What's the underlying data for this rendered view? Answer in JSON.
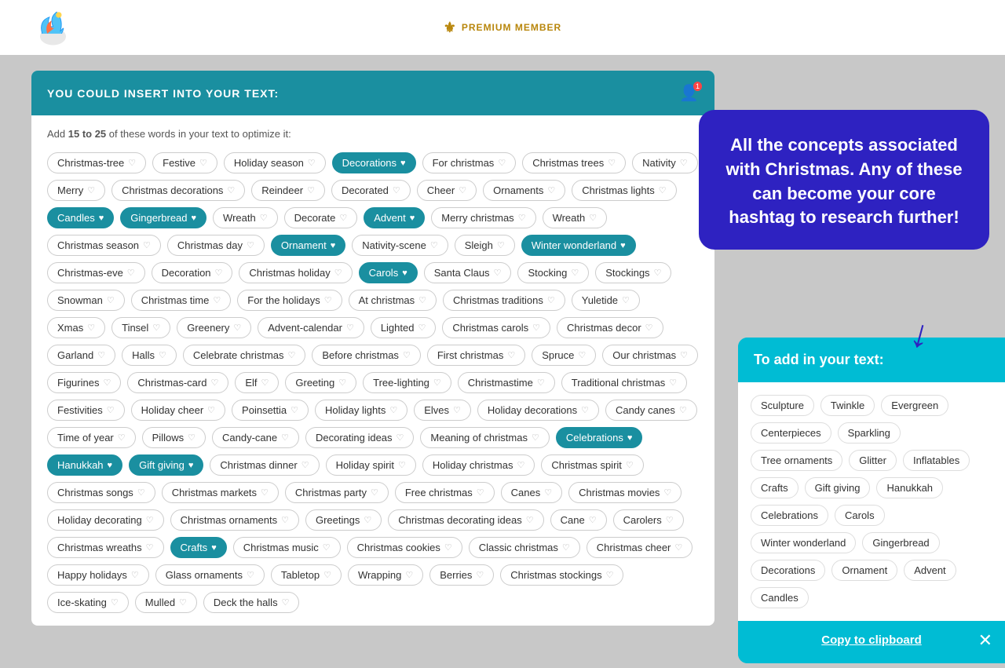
{
  "header": {
    "premium_label": "PREMIUM MEMBER"
  },
  "card": {
    "header_title": "YOU COULD INSERT INTO YOUR TEXT:",
    "instruction": "Add",
    "instruction_bold": "15 to 25",
    "instruction_rest": "of these words in your text to optimize it:"
  },
  "tags": [
    {
      "label": "Christmas-tree",
      "state": "normal"
    },
    {
      "label": "Festive",
      "state": "normal"
    },
    {
      "label": "Holiday season",
      "state": "normal"
    },
    {
      "label": "Decorations",
      "state": "selected-blue"
    },
    {
      "label": "For christmas",
      "state": "normal"
    },
    {
      "label": "Christmas trees",
      "state": "normal"
    },
    {
      "label": "Nativity",
      "state": "normal"
    },
    {
      "label": "Merry",
      "state": "normal"
    },
    {
      "label": "Christmas decorations",
      "state": "normal"
    },
    {
      "label": "Reindeer",
      "state": "normal"
    },
    {
      "label": "Decorated",
      "state": "normal"
    },
    {
      "label": "Cheer",
      "state": "normal"
    },
    {
      "label": "Ornaments",
      "state": "normal"
    },
    {
      "label": "Christmas lights",
      "state": "normal"
    },
    {
      "label": "Candles",
      "state": "selected-blue"
    },
    {
      "label": "Gingerbread",
      "state": "selected-blue"
    },
    {
      "label": "Wreath",
      "state": "normal"
    },
    {
      "label": "Decorate",
      "state": "normal"
    },
    {
      "label": "Advent",
      "state": "selected-blue"
    },
    {
      "label": "Merry christmas",
      "state": "normal"
    },
    {
      "label": "Wreath",
      "state": "normal"
    },
    {
      "label": "Christmas season",
      "state": "normal"
    },
    {
      "label": "Christmas day",
      "state": "normal"
    },
    {
      "label": "Ornament",
      "state": "selected-blue"
    },
    {
      "label": "Nativity-scene",
      "state": "normal"
    },
    {
      "label": "Sleigh",
      "state": "normal"
    },
    {
      "label": "Winter wonderland",
      "state": "selected-blue"
    },
    {
      "label": "Christmas-eve",
      "state": "normal"
    },
    {
      "label": "Decoration",
      "state": "normal"
    },
    {
      "label": "Christmas holiday",
      "state": "normal"
    },
    {
      "label": "Carols",
      "state": "selected-blue"
    },
    {
      "label": "Santa Claus",
      "state": "normal"
    },
    {
      "label": "Stocking",
      "state": "normal"
    },
    {
      "label": "Stockings",
      "state": "normal"
    },
    {
      "label": "Snowman",
      "state": "normal"
    },
    {
      "label": "Christmas time",
      "state": "normal"
    },
    {
      "label": "For the holidays",
      "state": "normal"
    },
    {
      "label": "At christmas",
      "state": "normal"
    },
    {
      "label": "Christmas traditions",
      "state": "normal"
    },
    {
      "label": "Yuletide",
      "state": "normal"
    },
    {
      "label": "Xmas",
      "state": "normal"
    },
    {
      "label": "Tinsel",
      "state": "normal"
    },
    {
      "label": "Greenery",
      "state": "normal"
    },
    {
      "label": "Advent-calendar",
      "state": "normal"
    },
    {
      "label": "Lighted",
      "state": "normal"
    },
    {
      "label": "Christmas carols",
      "state": "normal"
    },
    {
      "label": "Christmas decor",
      "state": "normal"
    },
    {
      "label": "Garland",
      "state": "normal"
    },
    {
      "label": "Halls",
      "state": "normal"
    },
    {
      "label": "Celebrate christmas",
      "state": "normal"
    },
    {
      "label": "Before christmas",
      "state": "normal"
    },
    {
      "label": "First christmas",
      "state": "normal"
    },
    {
      "label": "Spruce",
      "state": "normal"
    },
    {
      "label": "Our christmas",
      "state": "normal"
    },
    {
      "label": "Figurines",
      "state": "normal"
    },
    {
      "label": "Christmas-card",
      "state": "normal"
    },
    {
      "label": "Elf",
      "state": "normal"
    },
    {
      "label": "Greeting",
      "state": "normal"
    },
    {
      "label": "Tree-lighting",
      "state": "normal"
    },
    {
      "label": "Christmastime",
      "state": "normal"
    },
    {
      "label": "Traditional christmas",
      "state": "normal"
    },
    {
      "label": "Festivities",
      "state": "normal"
    },
    {
      "label": "Holiday cheer",
      "state": "normal"
    },
    {
      "label": "Poinsettia",
      "state": "normal"
    },
    {
      "label": "Holiday lights",
      "state": "normal"
    },
    {
      "label": "Elves",
      "state": "normal"
    },
    {
      "label": "Holiday decorations",
      "state": "normal"
    },
    {
      "label": "Candy canes",
      "state": "normal"
    },
    {
      "label": "Time of year",
      "state": "normal"
    },
    {
      "label": "Pillows",
      "state": "normal"
    },
    {
      "label": "Candy-cane",
      "state": "normal"
    },
    {
      "label": "Decorating ideas",
      "state": "normal"
    },
    {
      "label": "Meaning of christmas",
      "state": "normal"
    },
    {
      "label": "Celebrations",
      "state": "selected-blue"
    },
    {
      "label": "Hanukkah",
      "state": "selected-blue"
    },
    {
      "label": "Gift giving",
      "state": "selected-blue"
    },
    {
      "label": "Christmas dinner",
      "state": "normal"
    },
    {
      "label": "Holiday spirit",
      "state": "normal"
    },
    {
      "label": "Holiday christmas",
      "state": "normal"
    },
    {
      "label": "Christmas spirit",
      "state": "normal"
    },
    {
      "label": "Christmas songs",
      "state": "normal"
    },
    {
      "label": "Christmas markets",
      "state": "normal"
    },
    {
      "label": "Christmas party",
      "state": "normal"
    },
    {
      "label": "Free christmas",
      "state": "normal"
    },
    {
      "label": "Canes",
      "state": "normal"
    },
    {
      "label": "Christmas movies",
      "state": "normal"
    },
    {
      "label": "Holiday decorating",
      "state": "normal"
    },
    {
      "label": "Christmas ornaments",
      "state": "normal"
    },
    {
      "label": "Greetings",
      "state": "normal"
    },
    {
      "label": "Christmas decorating ideas",
      "state": "normal"
    },
    {
      "label": "Cane",
      "state": "normal"
    },
    {
      "label": "Carolers",
      "state": "normal"
    },
    {
      "label": "Christmas wreaths",
      "state": "normal"
    },
    {
      "label": "Crafts",
      "state": "selected-blue"
    },
    {
      "label": "Christmas music",
      "state": "normal"
    },
    {
      "label": "Christmas cookies",
      "state": "normal"
    },
    {
      "label": "Classic christmas",
      "state": "normal"
    },
    {
      "label": "Christmas cheer",
      "state": "normal"
    },
    {
      "label": "Happy holidays",
      "state": "normal"
    },
    {
      "label": "Glass ornaments",
      "state": "normal"
    },
    {
      "label": "Tabletop",
      "state": "normal"
    },
    {
      "label": "Wrapping",
      "state": "normal"
    },
    {
      "label": "Berries",
      "state": "normal"
    },
    {
      "label": "Christmas stockings",
      "state": "normal"
    },
    {
      "label": "Ice-skating",
      "state": "normal"
    },
    {
      "label": "Mulled",
      "state": "normal"
    },
    {
      "label": "Deck the halls",
      "state": "normal"
    }
  ],
  "tooltip": {
    "text": "All the concepts associated with Christmas. Any of these can become your core hashtag to research further!"
  },
  "side_panel": {
    "header": "To add in your text:",
    "items": [
      "Sculpture",
      "Twinkle",
      "Evergreen",
      "Centerpieces",
      "Sparkling",
      "Tree ornaments",
      "Glitter",
      "Inflatables",
      "Crafts",
      "Gift giving",
      "Hanukkah",
      "Celebrations",
      "Carols",
      "Winter wonderland",
      "Gingerbread",
      "Decorations",
      "Ornament",
      "Advent",
      "Candles"
    ],
    "copy_label": "Copy to clipboard"
  }
}
